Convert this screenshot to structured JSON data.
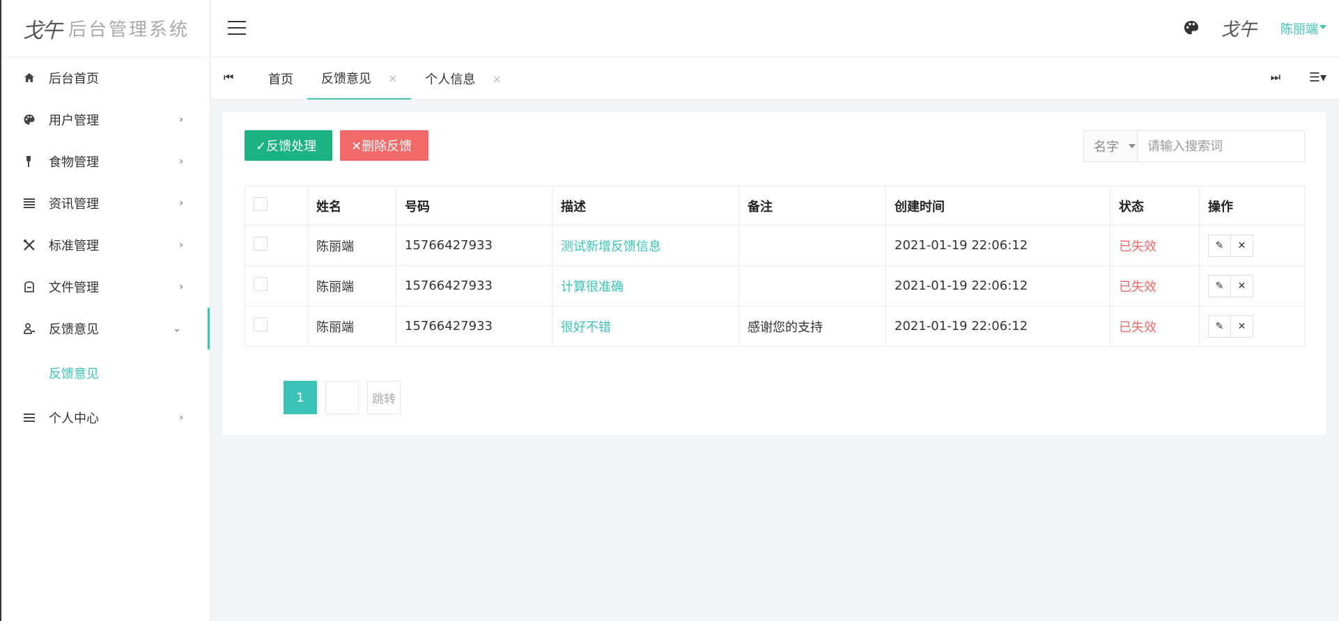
{
  "logo": {
    "mark": "戈午",
    "title": "后台管理系统"
  },
  "sidebar": {
    "items": [
      {
        "label": "后台首页",
        "icon": "home-icon"
      },
      {
        "label": "用户管理",
        "icon": "palette-icon",
        "arrow": "›"
      },
      {
        "label": "食物管理",
        "icon": "fork-icon",
        "arrow": "›"
      },
      {
        "label": "资讯管理",
        "icon": "list-icon",
        "arrow": "›"
      },
      {
        "label": "标准管理",
        "icon": "tools-icon",
        "arrow": "›"
      },
      {
        "label": "文件管理",
        "icon": "file-icon",
        "arrow": "›"
      },
      {
        "label": "反馈意见",
        "icon": "user-feedback-icon",
        "arrow": "⌄"
      },
      {
        "label": "个人中心",
        "icon": "menu-icon",
        "arrow": "›"
      }
    ],
    "submenu": {
      "label": "反馈意见"
    }
  },
  "header": {
    "avatar_text": "戈午",
    "user_name": "陈丽端"
  },
  "tabs": [
    {
      "label": "首页"
    },
    {
      "label": "反馈意见",
      "close": "×"
    },
    {
      "label": "个人信息",
      "close": "×"
    }
  ],
  "toolbar": {
    "process_label": "✓反馈处理",
    "delete_label": "✕删除反馈",
    "search_field": "名字",
    "search_placeholder": "请输入搜索词"
  },
  "table": {
    "headers": [
      "姓名",
      "号码",
      "描述",
      "备注",
      "创建时间",
      "状态",
      "操作"
    ],
    "rows": [
      {
        "name": "陈丽端",
        "phone": "15766427933",
        "desc": "测试新增反馈信息",
        "note": "",
        "time": "2021-01-19 22:06:12",
        "status": "已失效"
      },
      {
        "name": "陈丽端",
        "phone": "15766427933",
        "desc": "计算很准确",
        "note": "",
        "time": "2021-01-19 22:06:12",
        "status": "已失效"
      },
      {
        "name": "陈丽端",
        "phone": "15766427933",
        "desc": "很好不错",
        "note": "感谢您的支持",
        "time": "2021-01-19 22:06:12",
        "status": "已失效"
      }
    ]
  },
  "pager": {
    "current": "1",
    "go_label": "跳转"
  },
  "colors": {
    "accent": "#3cc3b7",
    "success": "#1ab381",
    "danger": "#f36a6a"
  }
}
